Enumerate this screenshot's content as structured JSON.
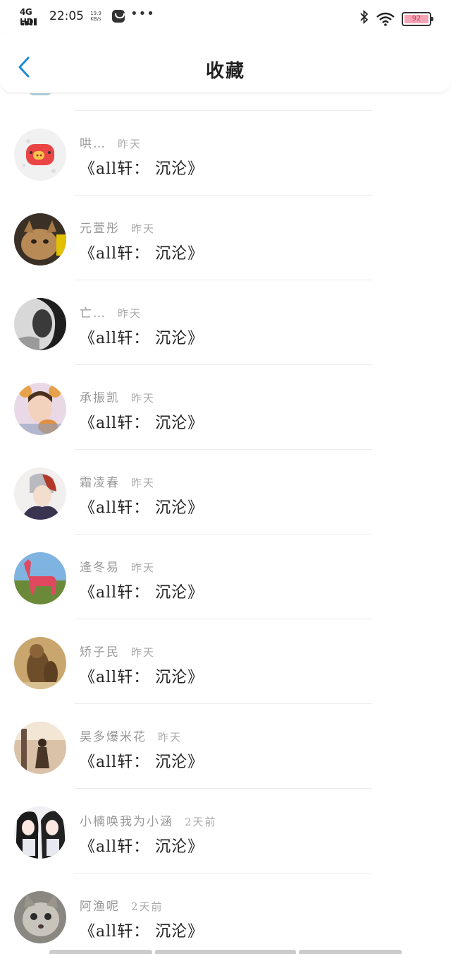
{
  "status_bar": {
    "network": "4G HD",
    "time": "22:05",
    "speed_value": "19.9",
    "speed_unit": "KB/s",
    "battery": "92",
    "colors": {
      "battery_fill": "#f5a3b6"
    }
  },
  "nav": {
    "title": "收藏",
    "back_icon": "chevron-left-icon",
    "accent": "#1e8ad8"
  },
  "items": [
    {
      "user": "哄…",
      "time": "昨天",
      "title": "《all轩： 沉沦》"
    },
    {
      "user": "元萱彤",
      "time": "昨天",
      "title": "《all轩： 沉沦》"
    },
    {
      "user": "亡…",
      "time": "昨天",
      "title": "《all轩： 沉沦》"
    },
    {
      "user": "承振凯",
      "time": "昨天",
      "title": "《all轩： 沉沦》"
    },
    {
      "user": "霜凌春",
      "time": "昨天",
      "title": "《all轩： 沉沦》"
    },
    {
      "user": "逄冬易",
      "time": "昨天",
      "title": "《all轩： 沉沦》"
    },
    {
      "user": "矫子民",
      "time": "昨天",
      "title": "《all轩： 沉沦》"
    },
    {
      "user": "昊多爆米花",
      "time": "昨天",
      "title": "《all轩： 沉沦》"
    },
    {
      "user": "小楠唤我为小涵",
      "time": "2天前",
      "title": "《all轩： 沉沦》"
    },
    {
      "user": "阿渔呢",
      "time": "2天前",
      "title": "《all轩： 沉沦》"
    }
  ]
}
